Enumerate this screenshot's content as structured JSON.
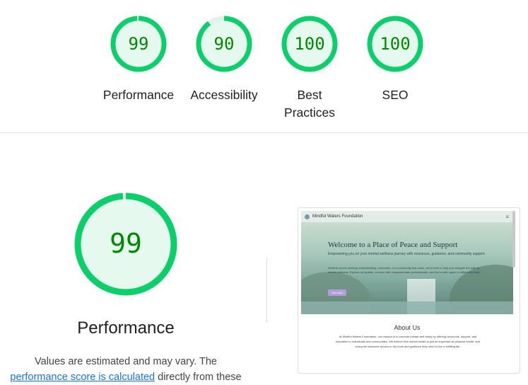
{
  "categories": [
    {
      "key": "performance",
      "score": "99",
      "score_value": 99,
      "label": "Performance"
    },
    {
      "key": "accessibility",
      "score": "90",
      "score_value": 90,
      "label": "Accessibility"
    },
    {
      "key": "best_practices",
      "score": "100",
      "score_value": 100,
      "label": "Best Practices"
    },
    {
      "key": "seo",
      "score": "100",
      "score_value": 100,
      "label": "SEO"
    }
  ],
  "colors": {
    "pass": "#0cce6b",
    "pass_fill": "#e6f9ef",
    "pass_text": "#008800",
    "track": "#e0f2e9"
  },
  "detail": {
    "score": "99",
    "score_value": 99,
    "title": "Performance",
    "desc_line1": "Values are estimated and may vary. The",
    "desc_link": "performance score is calculated",
    "desc_line2_rest": " directly from these"
  },
  "screenshot": {
    "site_name": "Mindful Waters Foundation",
    "hero_title": "Welcome to a Place of Peace and Support",
    "hero_sub": "Empowering you on your mental wellness journey with resources, guidance, and community support.",
    "hero_body": "Whether you're seeking understanding, resources, or a community that cares, we're here to help you navigate the path to mental wellness. Explore our guides, connect with compassionate professionals, and find a safe space to reflect and heal.",
    "hero_button": "Get help",
    "about_title": "About Us",
    "about_body": "At Mindful Waters Foundation, our mission is to promote mental well-being by offering resources, support, and education to individuals and communities. We believe that mental health is just as important as physical health, and everyone deserves access to the tools and guidance they need to live a fulfilling life."
  }
}
